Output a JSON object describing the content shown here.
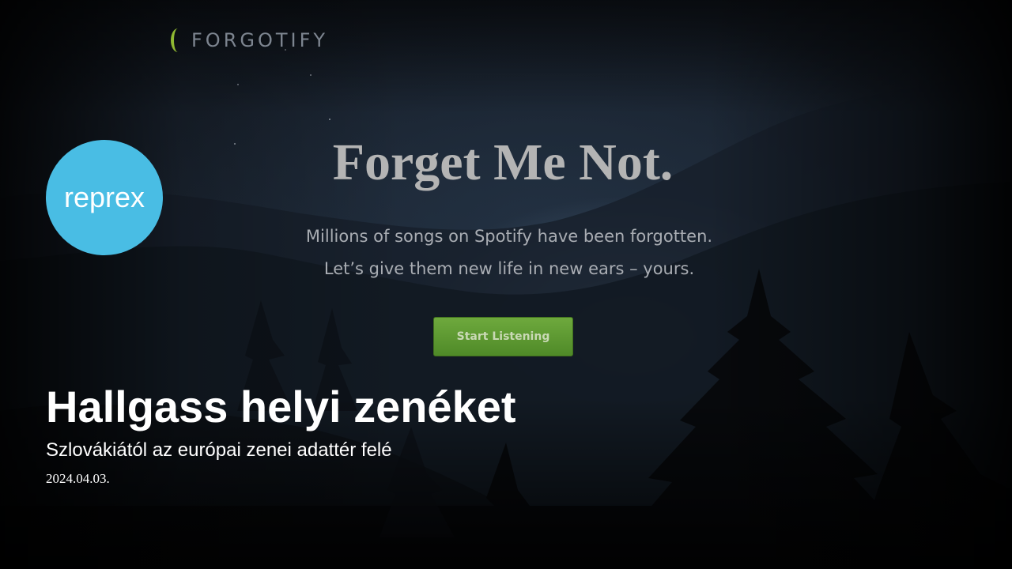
{
  "site": {
    "logo_text": "FORGOTIFY",
    "logo_icon": "crescent-moon-icon",
    "accent_color": "#8fb832"
  },
  "hero": {
    "title": "Forget Me Not.",
    "subtitle_line1": "Millions of songs on Spotify have been forgotten.",
    "subtitle_line2": "Let’s give them new life in new ears – yours.",
    "cta_label": "Start Listening",
    "cta_color": "#5c9a30"
  },
  "badge": {
    "label": "reprex",
    "color": "#49bde4"
  },
  "caption": {
    "headline": "Hallgass helyi zenéket",
    "subheadline": "Szlovákiától az európai zenei adattér felé",
    "date": "2024.04.03."
  }
}
